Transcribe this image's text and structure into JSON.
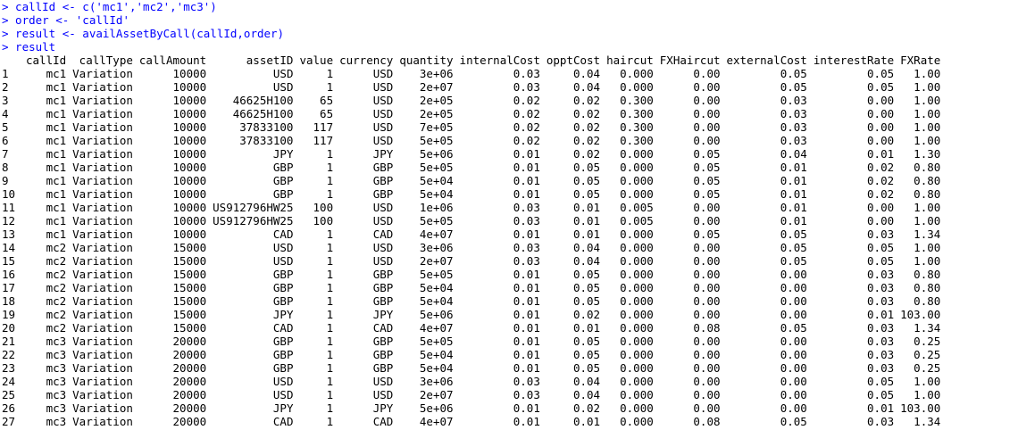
{
  "console": {
    "commands": [
      "> callId <- c('mc1','mc2','mc3')",
      "> order <- 'callId'",
      "> result <- availAssetByCall(callId,order)",
      "> result"
    ],
    "colors": {
      "command": "#0000ff",
      "output": "#000000",
      "background": "#ffffff"
    }
  },
  "table": {
    "headers": [
      "",
      "callId",
      "callType",
      "callAmount",
      "assetID",
      "value",
      "currency",
      "quantity",
      "internalCost",
      "opptCost",
      "haircut",
      "FXHaircut",
      "externalCost",
      "interestRate",
      "FXRate"
    ],
    "rows": [
      [
        "1",
        "mc1",
        "Variation",
        "10000",
        "USD",
        "1",
        "USD",
        "3e+06",
        "0.03",
        "0.04",
        "0.000",
        "0.00",
        "0.05",
        "0.05",
        "1.00"
      ],
      [
        "2",
        "mc1",
        "Variation",
        "10000",
        "USD",
        "1",
        "USD",
        "2e+07",
        "0.03",
        "0.04",
        "0.000",
        "0.00",
        "0.05",
        "0.05",
        "1.00"
      ],
      [
        "3",
        "mc1",
        "Variation",
        "10000",
        "46625H100",
        "65",
        "USD",
        "2e+05",
        "0.02",
        "0.02",
        "0.300",
        "0.00",
        "0.03",
        "0.00",
        "1.00"
      ],
      [
        "4",
        "mc1",
        "Variation",
        "10000",
        "46625H100",
        "65",
        "USD",
        "2e+05",
        "0.02",
        "0.02",
        "0.300",
        "0.00",
        "0.03",
        "0.00",
        "1.00"
      ],
      [
        "5",
        "mc1",
        "Variation",
        "10000",
        "37833100",
        "117",
        "USD",
        "7e+05",
        "0.02",
        "0.02",
        "0.300",
        "0.00",
        "0.03",
        "0.00",
        "1.00"
      ],
      [
        "6",
        "mc1",
        "Variation",
        "10000",
        "37833100",
        "117",
        "USD",
        "5e+05",
        "0.02",
        "0.02",
        "0.300",
        "0.00",
        "0.03",
        "0.00",
        "1.00"
      ],
      [
        "7",
        "mc1",
        "Variation",
        "10000",
        "JPY",
        "1",
        "JPY",
        "5e+06",
        "0.01",
        "0.02",
        "0.000",
        "0.05",
        "0.04",
        "0.01",
        "1.30"
      ],
      [
        "8",
        "mc1",
        "Variation",
        "10000",
        "GBP",
        "1",
        "GBP",
        "5e+05",
        "0.01",
        "0.05",
        "0.000",
        "0.05",
        "0.01",
        "0.02",
        "0.80"
      ],
      [
        "9",
        "mc1",
        "Variation",
        "10000",
        "GBP",
        "1",
        "GBP",
        "5e+04",
        "0.01",
        "0.05",
        "0.000",
        "0.05",
        "0.01",
        "0.02",
        "0.80"
      ],
      [
        "10",
        "mc1",
        "Variation",
        "10000",
        "GBP",
        "1",
        "GBP",
        "5e+04",
        "0.01",
        "0.05",
        "0.000",
        "0.05",
        "0.01",
        "0.02",
        "0.80"
      ],
      [
        "11",
        "mc1",
        "Variation",
        "10000",
        "US912796HW25",
        "100",
        "USD",
        "1e+06",
        "0.03",
        "0.01",
        "0.005",
        "0.00",
        "0.01",
        "0.00",
        "1.00"
      ],
      [
        "12",
        "mc1",
        "Variation",
        "10000",
        "US912796HW25",
        "100",
        "USD",
        "5e+05",
        "0.03",
        "0.01",
        "0.005",
        "0.00",
        "0.01",
        "0.00",
        "1.00"
      ],
      [
        "13",
        "mc1",
        "Variation",
        "10000",
        "CAD",
        "1",
        "CAD",
        "4e+07",
        "0.01",
        "0.01",
        "0.000",
        "0.05",
        "0.05",
        "0.03",
        "1.34"
      ],
      [
        "14",
        "mc2",
        "Variation",
        "15000",
        "USD",
        "1",
        "USD",
        "3e+06",
        "0.03",
        "0.04",
        "0.000",
        "0.00",
        "0.05",
        "0.05",
        "1.00"
      ],
      [
        "15",
        "mc2",
        "Variation",
        "15000",
        "USD",
        "1",
        "USD",
        "2e+07",
        "0.03",
        "0.04",
        "0.000",
        "0.00",
        "0.05",
        "0.05",
        "1.00"
      ],
      [
        "16",
        "mc2",
        "Variation",
        "15000",
        "GBP",
        "1",
        "GBP",
        "5e+05",
        "0.01",
        "0.05",
        "0.000",
        "0.00",
        "0.00",
        "0.03",
        "0.80"
      ],
      [
        "17",
        "mc2",
        "Variation",
        "15000",
        "GBP",
        "1",
        "GBP",
        "5e+04",
        "0.01",
        "0.05",
        "0.000",
        "0.00",
        "0.00",
        "0.03",
        "0.80"
      ],
      [
        "18",
        "mc2",
        "Variation",
        "15000",
        "GBP",
        "1",
        "GBP",
        "5e+04",
        "0.01",
        "0.05",
        "0.000",
        "0.00",
        "0.00",
        "0.03",
        "0.80"
      ],
      [
        "19",
        "mc2",
        "Variation",
        "15000",
        "JPY",
        "1",
        "JPY",
        "5e+06",
        "0.01",
        "0.02",
        "0.000",
        "0.00",
        "0.00",
        "0.01",
        "103.00"
      ],
      [
        "20",
        "mc2",
        "Variation",
        "15000",
        "CAD",
        "1",
        "CAD",
        "4e+07",
        "0.01",
        "0.01",
        "0.000",
        "0.08",
        "0.05",
        "0.03",
        "1.34"
      ],
      [
        "21",
        "mc3",
        "Variation",
        "20000",
        "GBP",
        "1",
        "GBP",
        "5e+05",
        "0.01",
        "0.05",
        "0.000",
        "0.00",
        "0.00",
        "0.03",
        "0.25"
      ],
      [
        "22",
        "mc3",
        "Variation",
        "20000",
        "GBP",
        "1",
        "GBP",
        "5e+04",
        "0.01",
        "0.05",
        "0.000",
        "0.00",
        "0.00",
        "0.03",
        "0.25"
      ],
      [
        "23",
        "mc3",
        "Variation",
        "20000",
        "GBP",
        "1",
        "GBP",
        "5e+04",
        "0.01",
        "0.05",
        "0.000",
        "0.00",
        "0.00",
        "0.03",
        "0.25"
      ],
      [
        "24",
        "mc3",
        "Variation",
        "20000",
        "USD",
        "1",
        "USD",
        "3e+06",
        "0.03",
        "0.04",
        "0.000",
        "0.00",
        "0.00",
        "0.05",
        "1.00"
      ],
      [
        "25",
        "mc3",
        "Variation",
        "20000",
        "USD",
        "1",
        "USD",
        "2e+07",
        "0.03",
        "0.04",
        "0.000",
        "0.00",
        "0.00",
        "0.05",
        "1.00"
      ],
      [
        "26",
        "mc3",
        "Variation",
        "20000",
        "JPY",
        "1",
        "JPY",
        "5e+06",
        "0.01",
        "0.02",
        "0.000",
        "0.00",
        "0.00",
        "0.01",
        "103.00"
      ],
      [
        "27",
        "mc3",
        "Variation",
        "20000",
        "CAD",
        "1",
        "CAD",
        "4e+07",
        "0.01",
        "0.01",
        "0.000",
        "0.08",
        "0.05",
        "0.03",
        "1.34"
      ]
    ]
  }
}
